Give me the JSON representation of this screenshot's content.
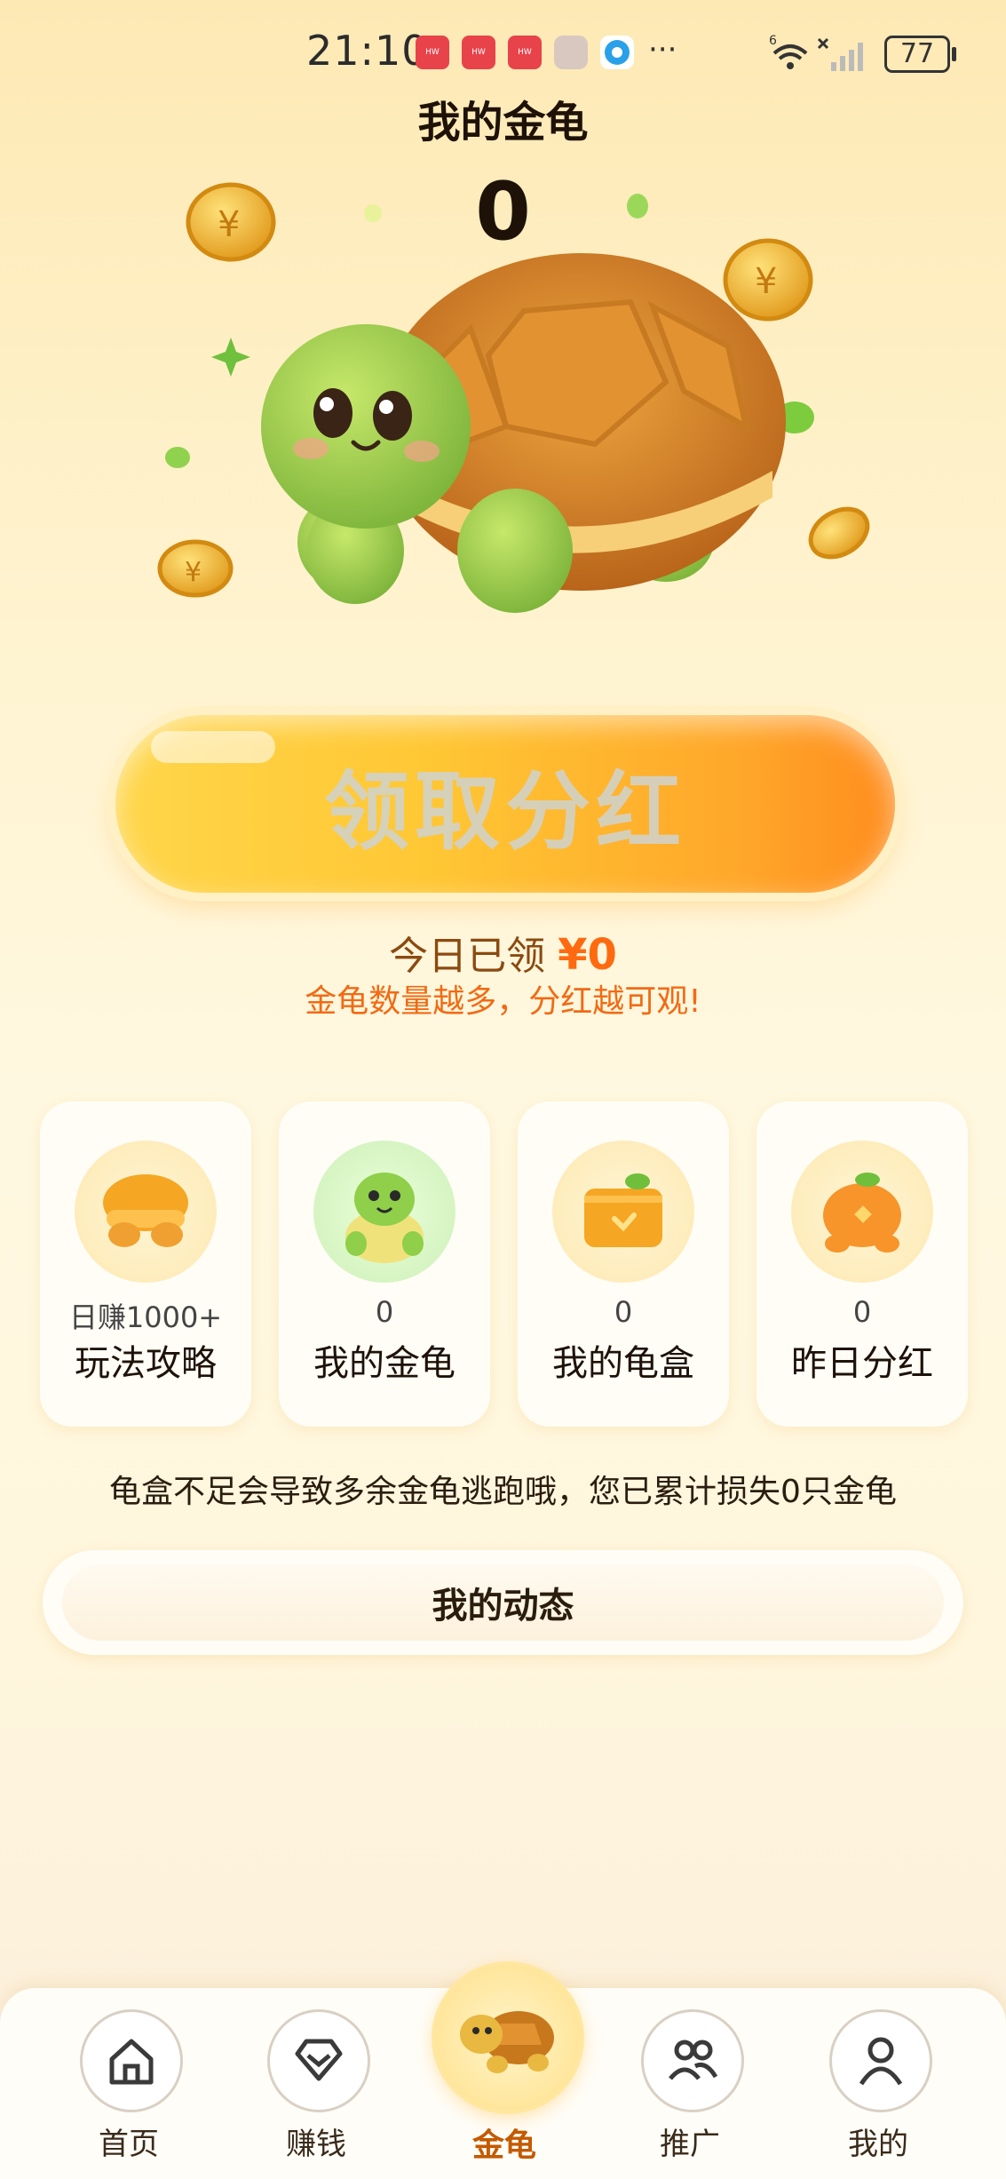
{
  "status_bar": {
    "time": "21:10",
    "battery": "77",
    "more": "···",
    "network": "6"
  },
  "header": {
    "title": "我的金龟",
    "count": "0"
  },
  "claim_button": {
    "label": "领取分红"
  },
  "claimed": {
    "prefix": "今日已领",
    "amount": "¥0"
  },
  "hint": "金龟数量越多，分红越可观!",
  "cards": [
    {
      "value": "日赚1000+",
      "label": "玩法攻略",
      "icon": "turtle-shell-icon"
    },
    {
      "value": "0",
      "label": "我的金龟",
      "icon": "green-turtle-icon"
    },
    {
      "value": "0",
      "label": "我的龟盒",
      "icon": "gift-box-icon"
    },
    {
      "value": "0",
      "label": "昨日分红",
      "icon": "orange-turtle-icon"
    }
  ],
  "warning": "龟盒不足会导致多余金龟逃跑哦，您已累计损失0只金龟",
  "dynamic_button": "我的动态",
  "nav": [
    {
      "label": "首页",
      "icon": "home-icon"
    },
    {
      "label": "赚钱",
      "icon": "diamond-icon"
    },
    {
      "label": "金龟",
      "icon": "turtle-icon"
    },
    {
      "label": "推广",
      "icon": "people-icon"
    },
    {
      "label": "我的",
      "icon": "person-icon"
    }
  ],
  "colors": {
    "accent": "#ff8d1e",
    "brand_gold": "#ffc734",
    "text_orange": "#f26a14"
  }
}
